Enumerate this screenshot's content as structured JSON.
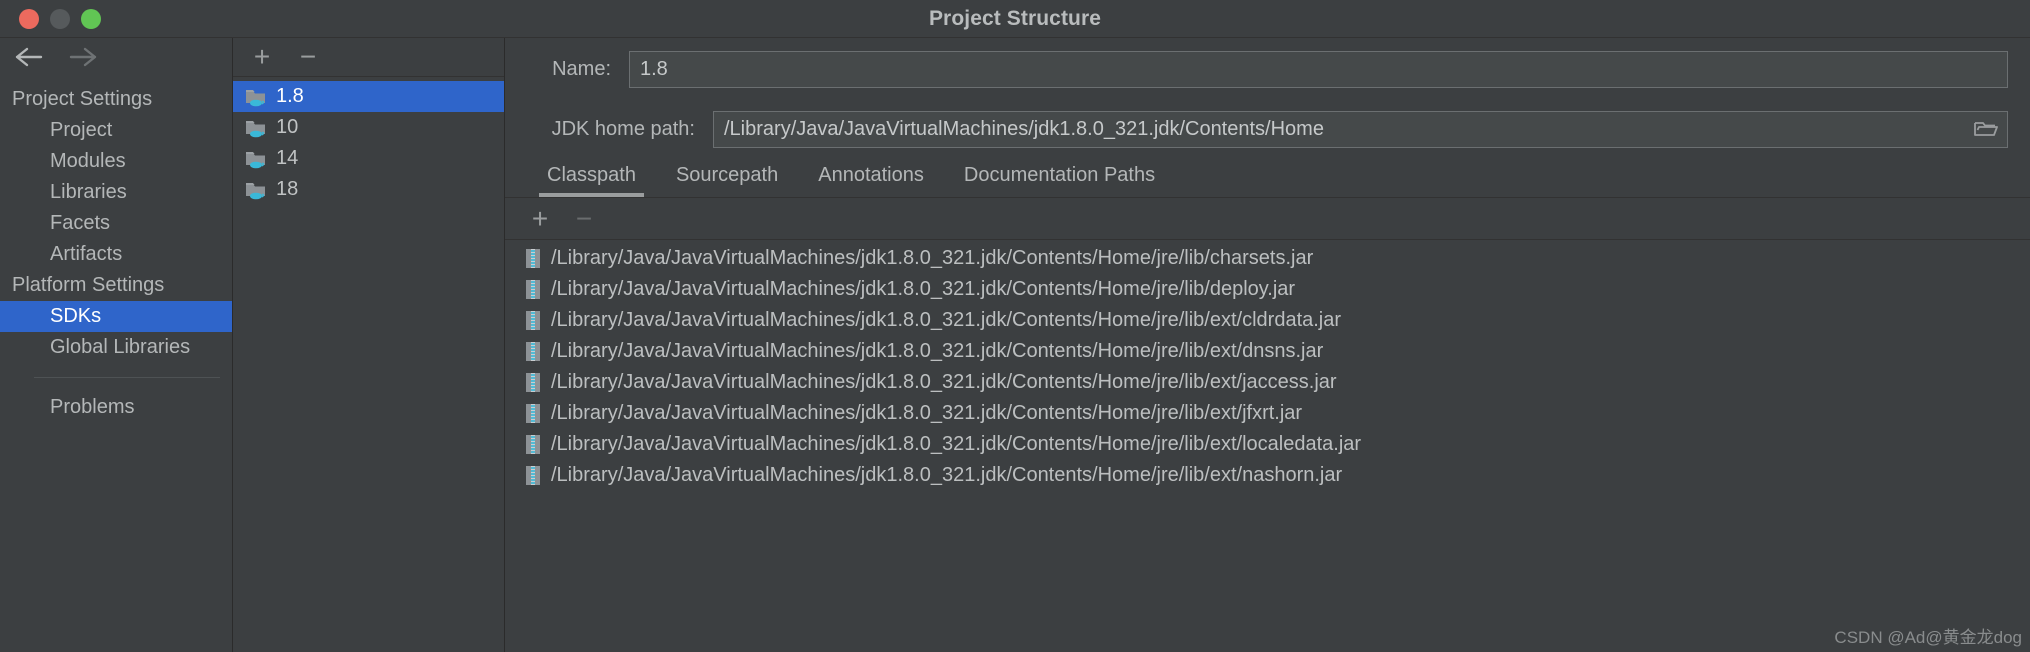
{
  "window": {
    "title": "Project Structure",
    "traffic_lights": [
      "close",
      "minimize",
      "maximize"
    ]
  },
  "nav": {
    "back_icon": "arrow-left-icon",
    "forward_icon": "arrow-right-icon"
  },
  "sidebar": {
    "items": [
      {
        "label": "Project Settings",
        "type": "group",
        "selected": false
      },
      {
        "label": "Project",
        "type": "child",
        "selected": false
      },
      {
        "label": "Modules",
        "type": "child",
        "selected": false
      },
      {
        "label": "Libraries",
        "type": "child",
        "selected": false
      },
      {
        "label": "Facets",
        "type": "child",
        "selected": false
      },
      {
        "label": "Artifacts",
        "type": "child",
        "selected": false
      },
      {
        "label": "Platform Settings",
        "type": "group",
        "selected": false
      },
      {
        "label": "SDKs",
        "type": "child",
        "selected": true
      },
      {
        "label": "Global Libraries",
        "type": "child",
        "selected": false
      },
      {
        "label": "Problems",
        "type": "child",
        "selected": false
      }
    ]
  },
  "sdk_panel": {
    "add_label": "+",
    "remove_label": "−",
    "items": [
      {
        "label": "1.8",
        "selected": true
      },
      {
        "label": "10",
        "selected": false
      },
      {
        "label": "14",
        "selected": false
      },
      {
        "label": "18",
        "selected": false
      }
    ]
  },
  "detail": {
    "name_label": "Name:",
    "name_value": "1.8",
    "jdk_path_label": "JDK home path:",
    "jdk_path_value": "/Library/Java/JavaVirtualMachines/jdk1.8.0_321.jdk/Contents/Home",
    "browse_icon": "folder-open-icon",
    "tabs": [
      {
        "label": "Classpath",
        "active": true
      },
      {
        "label": "Sourcepath",
        "active": false
      },
      {
        "label": "Annotations",
        "active": false
      },
      {
        "label": "Documentation Paths",
        "active": false
      }
    ],
    "classpath_toolbar": {
      "add_label": "+",
      "remove_label": "−"
    },
    "classpath_entries": [
      "/Library/Java/JavaVirtualMachines/jdk1.8.0_321.jdk/Contents/Home/jre/lib/charsets.jar",
      "/Library/Java/JavaVirtualMachines/jdk1.8.0_321.jdk/Contents/Home/jre/lib/deploy.jar",
      "/Library/Java/JavaVirtualMachines/jdk1.8.0_321.jdk/Contents/Home/jre/lib/ext/cldrdata.jar",
      "/Library/Java/JavaVirtualMachines/jdk1.8.0_321.jdk/Contents/Home/jre/lib/ext/dnsns.jar",
      "/Library/Java/JavaVirtualMachines/jdk1.8.0_321.jdk/Contents/Home/jre/lib/ext/jaccess.jar",
      "/Library/Java/JavaVirtualMachines/jdk1.8.0_321.jdk/Contents/Home/jre/lib/ext/jfxrt.jar",
      "/Library/Java/JavaVirtualMachines/jdk1.8.0_321.jdk/Contents/Home/jre/lib/ext/localedata.jar",
      "/Library/Java/JavaVirtualMachines/jdk1.8.0_321.jdk/Contents/Home/jre/lib/ext/nashorn.jar"
    ]
  },
  "watermark": "CSDN @Ad@黄金龙dog",
  "colors": {
    "background": "#3c3f41",
    "selection": "#2f65ca",
    "text": "#b4b7b8",
    "accent_cyan": "#3ab8d8"
  }
}
